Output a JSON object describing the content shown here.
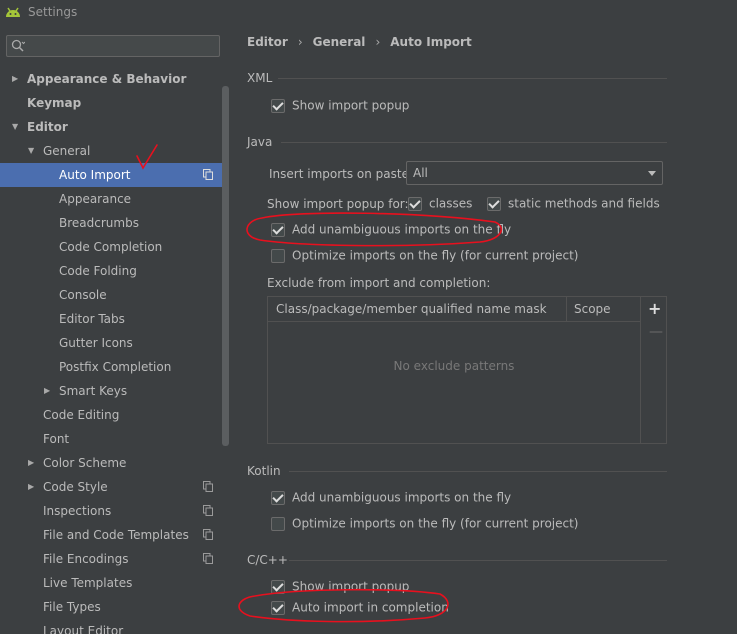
{
  "window": {
    "title": "Settings"
  },
  "sidebar": {
    "search": {
      "placeholder": ""
    },
    "items": [
      {
        "label": "Appearance & Behavior",
        "level": 0,
        "arrow": "collapsed",
        "bold": true
      },
      {
        "label": "Keymap",
        "level": 0,
        "arrow": "none",
        "bold": true
      },
      {
        "label": "Editor",
        "level": 0,
        "arrow": "expanded",
        "bold": true
      },
      {
        "label": "General",
        "level": 1,
        "arrow": "expanded"
      },
      {
        "label": "Auto Import",
        "level": 2,
        "arrow": "none",
        "selected": true,
        "copy_icon": true
      },
      {
        "label": "Appearance",
        "level": 2,
        "arrow": "none"
      },
      {
        "label": "Breadcrumbs",
        "level": 2,
        "arrow": "none"
      },
      {
        "label": "Code Completion",
        "level": 2,
        "arrow": "none"
      },
      {
        "label": "Code Folding",
        "level": 2,
        "arrow": "none"
      },
      {
        "label": "Console",
        "level": 2,
        "arrow": "none"
      },
      {
        "label": "Editor Tabs",
        "level": 2,
        "arrow": "none"
      },
      {
        "label": "Gutter Icons",
        "level": 2,
        "arrow": "none"
      },
      {
        "label": "Postfix Completion",
        "level": 2,
        "arrow": "none"
      },
      {
        "label": "Smart Keys",
        "level": 2,
        "arrow": "collapsed"
      },
      {
        "label": "Code Editing",
        "level": 1,
        "arrow": "none"
      },
      {
        "label": "Font",
        "level": 1,
        "arrow": "none"
      },
      {
        "label": "Color Scheme",
        "level": 1,
        "arrow": "collapsed"
      },
      {
        "label": "Code Style",
        "level": 1,
        "arrow": "collapsed",
        "copy_icon": true
      },
      {
        "label": "Inspections",
        "level": 1,
        "arrow": "none",
        "copy_icon": true
      },
      {
        "label": "File and Code Templates",
        "level": 1,
        "arrow": "none",
        "copy_icon": true
      },
      {
        "label": "File Encodings",
        "level": 1,
        "arrow": "none",
        "copy_icon": true
      },
      {
        "label": "Live Templates",
        "level": 1,
        "arrow": "none"
      },
      {
        "label": "File Types",
        "level": 1,
        "arrow": "none"
      },
      {
        "label": "Layout Editor",
        "level": 1,
        "arrow": "none"
      }
    ]
  },
  "breadcrumb": [
    "Editor",
    "General",
    "Auto Import"
  ],
  "xml": {
    "section": "XML",
    "show_import_popup": {
      "label": "Show import popup",
      "checked": true
    }
  },
  "java": {
    "section": "Java",
    "insert_imports_label": "Insert imports on paste:",
    "insert_imports_value": "All",
    "show_popup_for_label": "Show import popup for:",
    "classes": {
      "label": "classes",
      "checked": true
    },
    "static_methods": {
      "label": "static methods and fields",
      "checked": true
    },
    "add_unambiguous": {
      "label": "Add unambiguous imports on the fly",
      "checked": true
    },
    "optimize_imports": {
      "label": "Optimize imports on the fly (for current project)",
      "checked": false
    },
    "exclude_label": "Exclude from import and completion:",
    "table": {
      "columns": [
        "Class/package/member qualified name mask",
        "Scope"
      ],
      "empty_text": "No exclude patterns",
      "add_icon": "+",
      "remove_icon": "—"
    }
  },
  "kotlin": {
    "section": "Kotlin",
    "add_unambiguous": {
      "label": "Add unambiguous imports on the fly",
      "checked": true
    },
    "optimize_imports": {
      "label": "Optimize imports on the fly (for current project)",
      "checked": false
    }
  },
  "cpp": {
    "section": "C/C++",
    "show_import_popup": {
      "label": "Show import popup",
      "checked": true
    },
    "auto_import_completion": {
      "label": "Auto import in completion",
      "checked": true
    }
  },
  "colors": {
    "selection": "#4b6eaf",
    "annotation_red": "#e8101e",
    "background": "#3c3f41"
  }
}
